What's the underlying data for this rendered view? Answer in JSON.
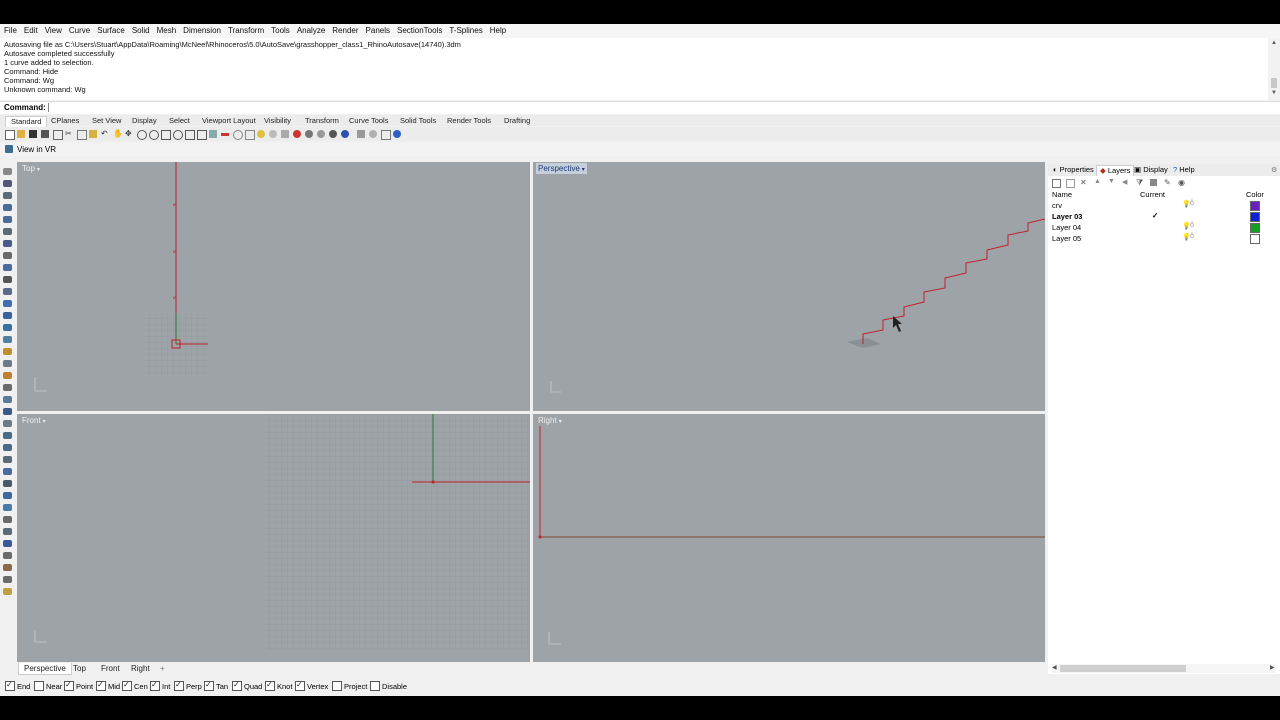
{
  "menu": [
    "File",
    "Edit",
    "View",
    "Curve",
    "Surface",
    "Solid",
    "Mesh",
    "Dimension",
    "Transform",
    "Tools",
    "Analyze",
    "Render",
    "Panels",
    "SectionTools",
    "T-Splines",
    "Help"
  ],
  "history": [
    "Autosaving file as C:\\Users\\Stuart\\AppData\\Roaming\\McNeel\\Rhinoceros\\5.0\\AutoSave\\grasshopper_class1_RhinoAutosave(14740).3dm",
    "Autosave completed successfully",
    "1 curve added to selection.",
    "Command: Hide",
    "Command: Wg",
    "Unknown command: Wg"
  ],
  "command": {
    "label": "Command:",
    "value": ""
  },
  "toolbar_tabs": [
    "Standard",
    "CPlanes",
    "Set View",
    "Display",
    "Select",
    "Viewport Layout",
    "Visibility",
    "Transform",
    "Curve Tools",
    "Solid Tools",
    "Render Tools",
    "Drafting"
  ],
  "vr_label": "View in VR",
  "viewports": {
    "top": "Top",
    "perspective": "Perspective",
    "front": "Front",
    "right": "Right"
  },
  "axis": {
    "x": "x",
    "y": "y"
  },
  "panel": {
    "tabs": [
      "Properties",
      "Layers",
      "Display",
      "Help"
    ],
    "col_name": "Name",
    "col_current": "Current",
    "col_color": "Color",
    "check": "✓",
    "layers": [
      {
        "name": "crv",
        "current": "",
        "color": "#6a1fbf",
        "bold": false
      },
      {
        "name": "Layer 03",
        "current": "✓",
        "color": "#1020d8",
        "bold": true
      },
      {
        "name": "Layer 04",
        "current": "",
        "color": "#14a020",
        "bold": false
      },
      {
        "name": "Layer 05",
        "current": "",
        "color": "#ffffff",
        "bold": false
      }
    ]
  },
  "bottom_tabs": [
    "Perspective",
    "Top",
    "Front",
    "Right",
    "+"
  ],
  "osnaps": [
    {
      "label": "End",
      "on": true
    },
    {
      "label": "Near",
      "on": false
    },
    {
      "label": "Point",
      "on": true
    },
    {
      "label": "Mid",
      "on": true
    },
    {
      "label": "Cen",
      "on": true
    },
    {
      "label": "Int",
      "on": true
    },
    {
      "label": "Perp",
      "on": true
    },
    {
      "label": "Tan",
      "on": true
    },
    {
      "label": "Quad",
      "on": true
    },
    {
      "label": "Knot",
      "on": true
    },
    {
      "label": "Vertex",
      "on": true
    },
    {
      "label": "Project",
      "on": false
    },
    {
      "label": "Disable",
      "on": false
    }
  ],
  "colors": {
    "curve": "#c0202a",
    "grid_bg": "#a4a9ae",
    "viewport_bg": "#9ea3a8",
    "accent": "#1c3a78"
  }
}
